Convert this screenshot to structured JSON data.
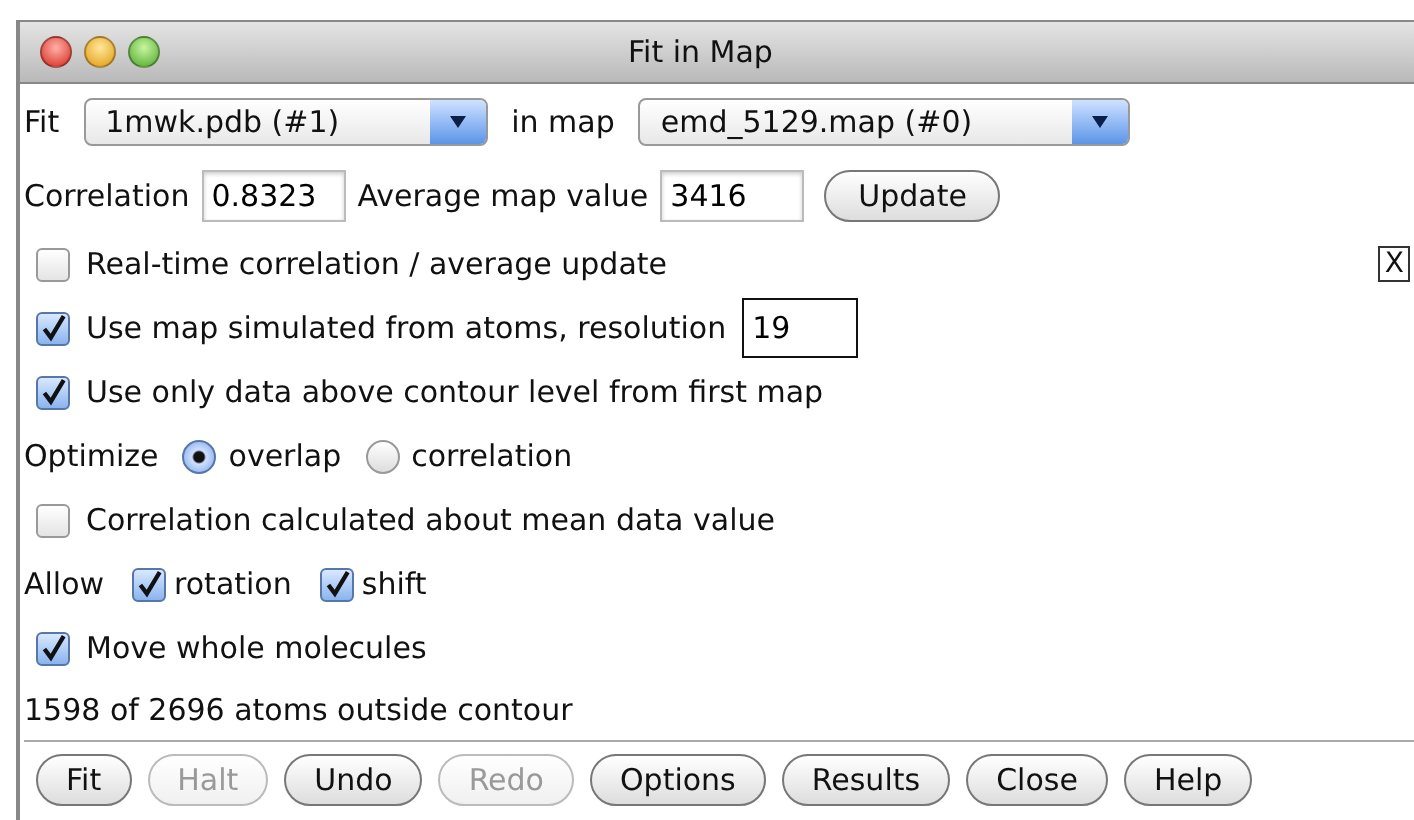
{
  "window": {
    "title": "Fit in Map"
  },
  "fit_row": {
    "label": "Fit",
    "model": "1mwk.pdb (#1)",
    "map_label": "in map",
    "map": "emd_5129.map (#0)"
  },
  "values_row": {
    "correlation_label": "Correlation",
    "correlation": "0.8323",
    "average_label": "Average map value",
    "average": "3416",
    "update_button": "Update"
  },
  "realtime": {
    "label": "Real-time correlation / average update",
    "checked": false,
    "close_box": "X"
  },
  "simulated": {
    "label": "Use map simulated from atoms, resolution",
    "checked": true,
    "resolution": "19"
  },
  "above_contour": {
    "label": "Use only data above contour level from first map",
    "checked": true
  },
  "optimize": {
    "label": "Optimize",
    "options": [
      {
        "label": "overlap",
        "selected": true
      },
      {
        "label": "correlation",
        "selected": false
      }
    ]
  },
  "mean_data": {
    "label": "Correlation calculated about mean data value",
    "checked": false
  },
  "allow": {
    "label": "Allow",
    "options": [
      {
        "label": "rotation",
        "checked": true
      },
      {
        "label": "shift",
        "checked": true
      }
    ]
  },
  "whole_molecules": {
    "label": "Move whole molecules",
    "checked": true
  },
  "status": "1598 of 2696 atoms outside contour",
  "buttons": [
    {
      "label": "Fit",
      "disabled": false
    },
    {
      "label": "Halt",
      "disabled": true
    },
    {
      "label": "Undo",
      "disabled": false
    },
    {
      "label": "Redo",
      "disabled": true
    },
    {
      "label": "Options",
      "disabled": false
    },
    {
      "label": "Results",
      "disabled": false
    },
    {
      "label": "Close",
      "disabled": false
    },
    {
      "label": "Help",
      "disabled": false
    }
  ]
}
